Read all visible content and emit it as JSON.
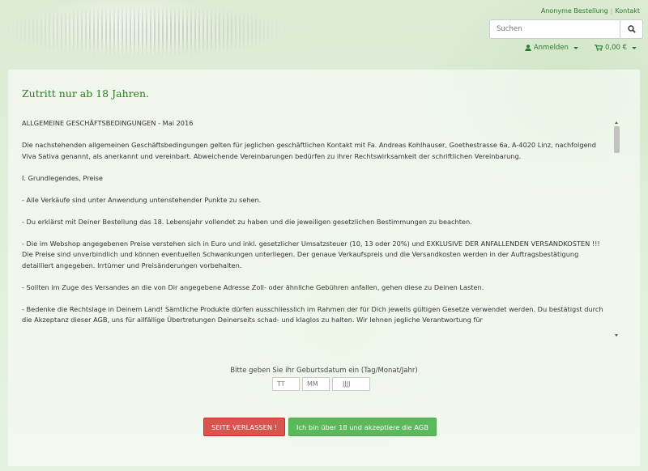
{
  "header": {
    "links": [
      "Anonyme Bestellung",
      "Kontakt"
    ],
    "search_placeholder": "Suchen",
    "login_label": "Anmelden",
    "cart_label": "0,00 €"
  },
  "age_gate": {
    "title": "Zutritt nur ab 18 Jahren.",
    "terms": [
      "ALLGEMEINE GESCHÄFTSBEDINGUNGEN - Mai 2016",
      "Die nachstehenden allgemeinen Geschäftsbedingungen gelten für jeglichen geschäftlichen Kontakt mit Fa. Andreas Kohlhauser, Goethestrasse 6a, A-4020 Linz, nachfolgend Viva Sativa genannt, als anerkannt und vereinbart. Abweichende Vereinbarungen bedürfen zu ihrer Rechtswirksamkeit der schriftlichen Vereinbarung.",
      "",
      "I. Grundlegendes, Preise",
      "- Alle Verkäufe sind unter Anwendung untenstehender Punkte zu sehen.",
      "- Du erklärst mit Deiner Bestellung das 18. Lebensjahr vollendet zu haben und die jeweiligen gesetzlichen Bestimmungen zu beachten.",
      "- Die im Webshop angegebenen Preise verstehen sich in Euro und inkl. gesetzlicher Umsatzsteuer (10, 13  oder 20%) und EXKLUSIVE DER ANFALLENDEN VERSANDKOSTEN !!! Die Preise sind unverbindlich und können eventuellen Schwankungen unterliegen. Der genaue Verkaufspreis und die Versandkosten werden in der Auftragsbestätigung detailliert angegeben. Irrtümer und Preisänderungen vorbehalten.",
      "- Sollten im Zuge des Versandes an die von Dir angegebene Adresse Zoll- oder ähnliche Gebühren anfallen, gehen diese zu Deinen Lasten.",
      "- Bedenke die Rechtslage in Deinem Land! Sämtliche Produkte dürfen ausschliesslich im Rahmen der für Dich jeweils gültigen Gesetze verwendet werden. Du bestätigst durch die Akzeptanz dieser AGB, uns für allfällige Übertretungen Deinerseits schad- und klaglos zu halten. Wir lehnen jegliche Verantwortung für"
    ],
    "dob_label": "Bitte geben Sie ihr Geburtsdatum ein (Tag/Monat/Jahr)",
    "dob_placeholders": {
      "day": "TT",
      "month": "MM",
      "year": "JJJJ"
    },
    "leave_button": "SEITE VERLASSEN !",
    "accept_button": "Ich bin über 18 und akzeptiere die AGB"
  },
  "colors": {
    "accent_green": "#2c7a1f",
    "leave_red": "#d9534f",
    "accept_green": "#5cb85c"
  }
}
